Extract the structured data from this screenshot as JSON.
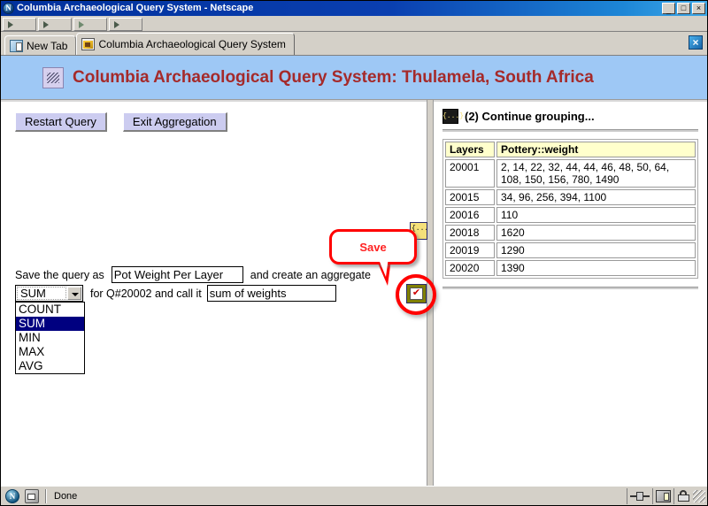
{
  "window": {
    "title": "Columbia Archaeological Query System - Netscape",
    "icon": "netscape-icon",
    "controls": {
      "minimize": "_",
      "maximize": "□",
      "close": "×"
    }
  },
  "toolbar": {
    "buttons": [
      "arrow-button-1",
      "arrow-button-2",
      "arrow-button-3",
      "arrow-button-4"
    ]
  },
  "tabs": {
    "items": [
      {
        "label": "New Tab",
        "icon": "new-tab-icon",
        "active": false
      },
      {
        "label": "Columbia Archaeological Query System",
        "icon": "page-icon",
        "active": true
      }
    ],
    "close_label": "×"
  },
  "banner": {
    "icon": "app-logo-icon",
    "title": "Columbia Archaeological Query System: Thulamela, South Africa",
    "bg_color": "#9ec8f5",
    "title_color": "#a52a2a"
  },
  "left_pane": {
    "buttons": [
      {
        "label": "Restart Query",
        "name": "restart-query-button"
      },
      {
        "label": "Exit Aggregation",
        "name": "exit-aggregation-button"
      }
    ],
    "line1": {
      "prefix": "Save the query as",
      "query_name_value": "Pot Weight Per Layer",
      "query_name_placeholder": "",
      "suffix": "and create an aggregate"
    },
    "line2": {
      "middle": "for Q#20002 and call it",
      "agg_name_value": "sum of weights",
      "agg_name_placeholder": ""
    },
    "select": {
      "selected": "SUM",
      "options": [
        "COUNT",
        "SUM",
        "MIN",
        "MAX",
        "AVG"
      ],
      "open": true
    },
    "callout": {
      "label": "Save",
      "color": "#ff0000",
      "target": "save-checkmark-button"
    },
    "corner_icon": "grouping-icon"
  },
  "right_pane": {
    "icon": "grouping-icon",
    "title": "(2) Continue grouping...",
    "table": {
      "columns": [
        "Layers",
        "Pottery::weight"
      ],
      "header_bg": "#ffffcc",
      "rows": [
        {
          "layer": "20001",
          "weight": "2, 14, 22, 32, 44, 44, 46, 48, 50, 64, 108, 150, 156, 780, 1490"
        },
        {
          "layer": "20015",
          "weight": "34, 96, 256, 394, 1100"
        },
        {
          "layer": "20016",
          "weight": "110"
        },
        {
          "layer": "20018",
          "weight": "1620"
        },
        {
          "layer": "20019",
          "weight": "1290"
        },
        {
          "layer": "20020",
          "weight": "1390"
        }
      ]
    }
  },
  "statusbar": {
    "text": "Done",
    "left_icons": [
      "netscape-globe-icon",
      "mail-icon"
    ],
    "right_icons": [
      "connection-icon",
      "security-view-icon",
      "lock-icon",
      "resize-grip-icon"
    ]
  }
}
